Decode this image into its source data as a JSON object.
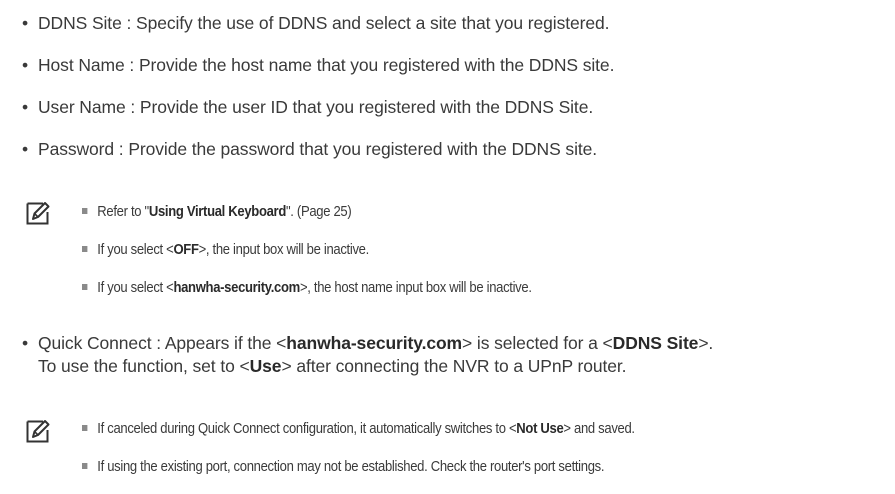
{
  "bullets": [
    {
      "label": "DDNS Site",
      "text": "Specify the use of DDNS and select a site that you registered."
    },
    {
      "label": "Host Name",
      "text": "Provide the host name that you registered with the DDNS site."
    },
    {
      "label": "User Name",
      "text": "Provide the user ID that you registered with the DDNS Site."
    },
    {
      "label": "Password",
      "text": "Provide the password that you registered with the DDNS site."
    }
  ],
  "note1": {
    "icon": "note-pencil-icon",
    "items": [
      {
        "pre": "Refer to \"",
        "bold": "Using Virtual Keyboard",
        "post": "\". (Page 25)"
      },
      {
        "pre": "If you select <",
        "bold": "OFF",
        "post": ">, the input box will be inactive."
      },
      {
        "pre": "If you select <",
        "bold": "hanwha-security.com",
        "post": ">, the host name input box will be inactive."
      }
    ]
  },
  "quick_connect": {
    "label": "Quick Connect",
    "t1": "Appears if the <",
    "b1": "hanwha-security.com",
    "t2": "> is selected for a <",
    "b2": "DDNS Site",
    "t3": ">.",
    "line2_pre": "To use the function, set to <",
    "line2_bold": "Use",
    "line2_post": "> after connecting the NVR to a UPnP router."
  },
  "note2": {
    "icon": "note-pencil-icon",
    "items": [
      {
        "pre": "If canceled during Quick Connect configuration, it automatically switches to <",
        "bold": "Not Use",
        "post": "> and saved."
      },
      {
        "pre": "If using the existing port, connection may not be established. Check the router's port settings.",
        "bold": "",
        "post": ""
      }
    ]
  }
}
